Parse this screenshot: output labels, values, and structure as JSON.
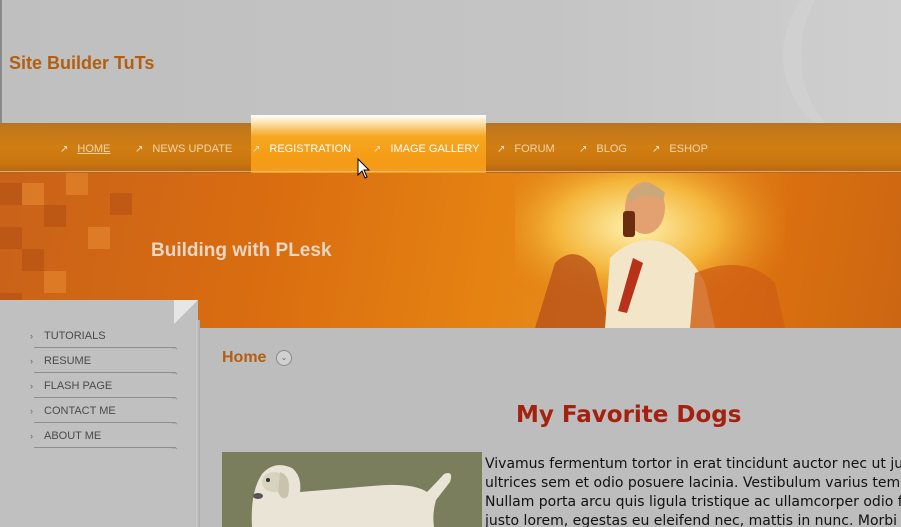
{
  "site": {
    "title": "Site Builder TuTs"
  },
  "nav": {
    "items": [
      {
        "label": "HOME"
      },
      {
        "label": "NEWS UPDATE"
      },
      {
        "label": "REGISTRATION"
      },
      {
        "label": "IMAGE GALLERY"
      },
      {
        "label": "FORUM"
      },
      {
        "label": "BLOG"
      },
      {
        "label": "ESHOP"
      }
    ]
  },
  "banner": {
    "title": "Building with PLesk"
  },
  "sidebar": {
    "items": [
      {
        "label": "TUTORIALS"
      },
      {
        "label": "RESUME"
      },
      {
        "label": "FLASH PAGE"
      },
      {
        "label": "CONTACT ME"
      },
      {
        "label": "ABOUT ME"
      }
    ]
  },
  "content": {
    "breadcrumb": "Home",
    "heading": "My Favorite Dogs",
    "paragraph_lines": [
      "Vivamus fermentum tortor in erat tincidunt auctor nec ut ju",
      "ultrices sem et odio posuere lacinia. Vestibulum varius tem",
      "Nullam porta arcu quis ligula tristique ac ullamcorper odio f",
      "justo lorem, egestas eu eleifend nec, mattis in nunc. Morbi"
    ]
  },
  "colors": {
    "brand_text": "#b35f10",
    "heading_red": "#a4200f",
    "nav_orange": "#d07e12",
    "page_gray": "#bdbdbd"
  }
}
